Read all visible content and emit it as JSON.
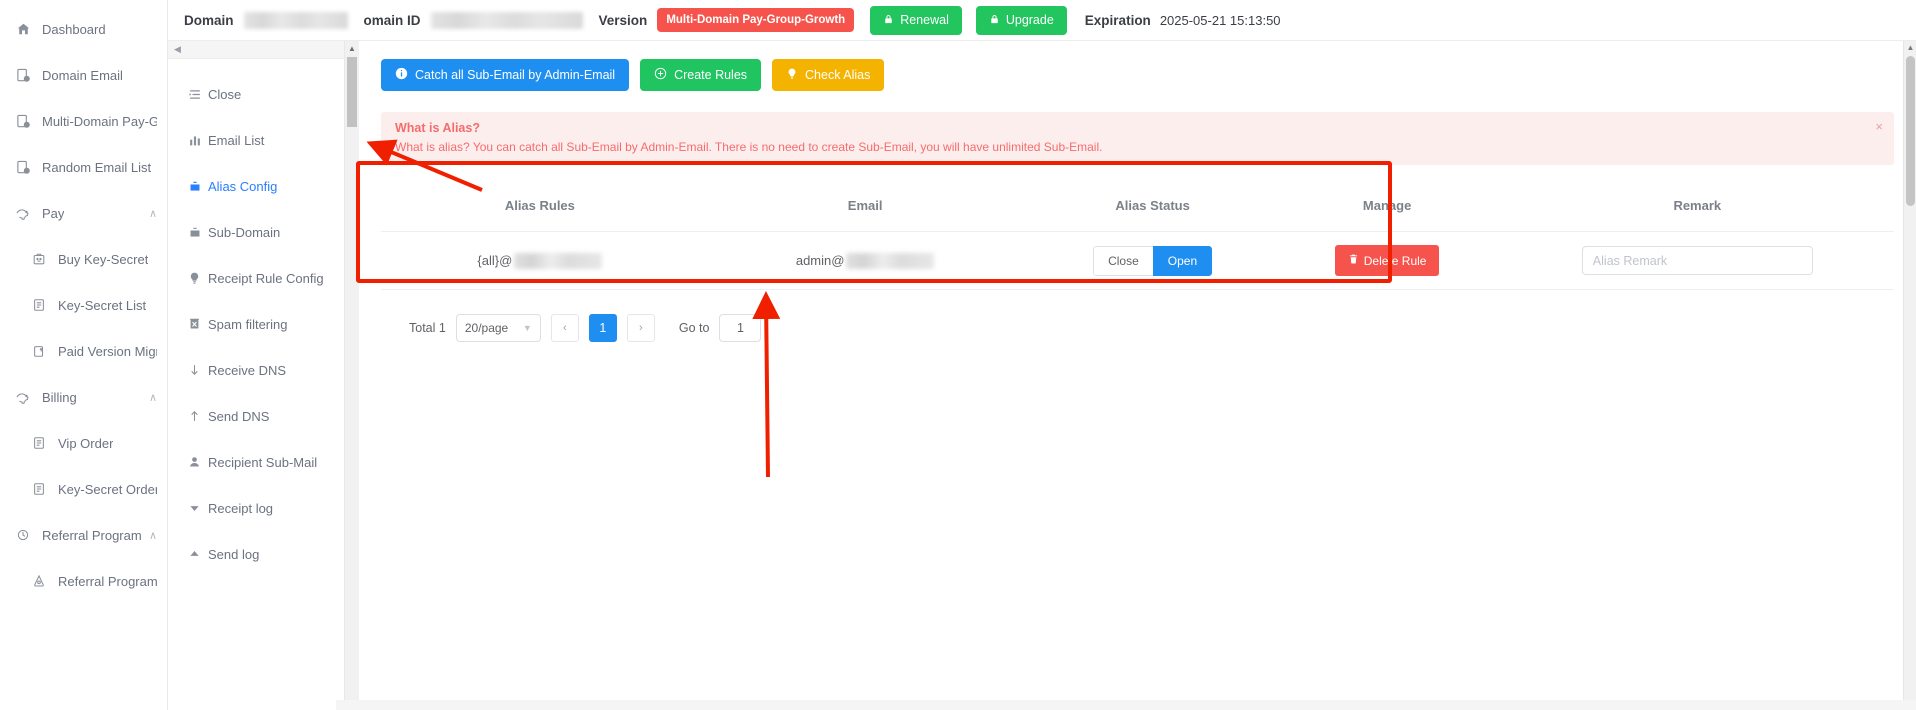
{
  "topbar": {
    "domain_label": "Domain",
    "domain_id_label": "omain ID",
    "version_label": "Version",
    "version_badge": "Multi-Domain Pay-Group-Growth",
    "renewal_button": "Renewal",
    "upgrade_button": "Upgrade",
    "expiration_label": "Expiration",
    "expiration_value": "2025-05-21 15:13:50"
  },
  "sidebar": {
    "items": [
      {
        "label": "Dashboard",
        "icon": "home-icon",
        "level": "top"
      },
      {
        "label": "Domain Email",
        "icon": "domain-icon",
        "level": "top"
      },
      {
        "label": "Multi-Domain Pay-Group",
        "icon": "domain-icon",
        "level": "top"
      },
      {
        "label": "Random Email List",
        "icon": "domain-icon",
        "level": "top"
      },
      {
        "label": "Pay",
        "icon": "pay-icon",
        "level": "group",
        "caret": "∧"
      },
      {
        "label": "Buy Key-Secret",
        "icon": "key-icon",
        "level": "sub"
      },
      {
        "label": "Key-Secret List",
        "icon": "list-icon",
        "level": "sub"
      },
      {
        "label": "Paid Version Migration",
        "icon": "upload-icon",
        "level": "sub"
      },
      {
        "label": "Billing",
        "icon": "pay-icon",
        "level": "group",
        "caret": "∧"
      },
      {
        "label": "Vip Order",
        "icon": "list-icon",
        "level": "sub"
      },
      {
        "label": "Key-Secret Order",
        "icon": "list-icon",
        "level": "sub"
      },
      {
        "label": "Referral Program",
        "icon": "gift-icon",
        "level": "group",
        "caret": "∧"
      },
      {
        "label": "Referral Program",
        "icon": "referral-icon",
        "level": "sub"
      }
    ]
  },
  "subsidebar": {
    "collapse_icon": "◀",
    "items": [
      {
        "label": "Close",
        "icon": "close-list-icon",
        "active": false
      },
      {
        "label": "Email List",
        "icon": "bar-chart-icon",
        "active": false
      },
      {
        "label": "Alias Config",
        "icon": "alias-icon",
        "active": true
      },
      {
        "label": "Sub-Domain",
        "icon": "subdomain-icon",
        "active": false
      },
      {
        "label": "Receipt Rule Config",
        "icon": "bulb-icon",
        "active": false
      },
      {
        "label": "Spam filtering",
        "icon": "spam-icon",
        "active": false
      },
      {
        "label": "Receive DNS",
        "icon": "arrow-down-icon",
        "active": false
      },
      {
        "label": "Send DNS",
        "icon": "arrow-up-icon",
        "active": false
      },
      {
        "label": "Recipient Sub-Mail",
        "icon": "user-icon",
        "active": false
      },
      {
        "label": "Receipt log",
        "icon": "triangle-down-icon",
        "active": false
      },
      {
        "label": "Send log",
        "icon": "triangle-up-icon",
        "active": false
      }
    ]
  },
  "toolbar": {
    "catch_all_button": "Catch all Sub-Email by Admin-Email",
    "catch_all_icon": "info-icon",
    "create_rules_button": "Create Rules",
    "create_rules_icon": "plus-circle-icon",
    "check_alias_button": "Check Alias",
    "check_alias_icon": "bulb-icon"
  },
  "alert": {
    "title": "What is Alias?",
    "description": "What is alias? You can catch all Sub-Email by Admin-Email. There is no need to create Sub-Email, you will have unlimited Sub-Email.",
    "close_icon": "×"
  },
  "table": {
    "headers": [
      "Alias Rules",
      "Email",
      "Alias Status",
      "Manage",
      "Remark"
    ],
    "rows": [
      {
        "alias_rule_prefix": "{all}@",
        "alias_rule_domain_redacted": true,
        "email_prefix": "admin@",
        "email_domain_redacted": true,
        "status_close_label": "Close",
        "status_open_label": "Open",
        "status_selected": "Open",
        "delete_label": "Delete Rule",
        "delete_icon": "trash-icon",
        "remark_value": "",
        "remark_placeholder": "Alias Remark"
      }
    ]
  },
  "pagination": {
    "total_label": "Total 1",
    "page_size": "20/page",
    "prev_icon": "‹",
    "next_icon": "›",
    "current_page": "1",
    "goto_label": "Go to",
    "goto_value": "1"
  },
  "annotations": {
    "highlight_color": "#f01f00",
    "arrow_to_alias_config": "arrow-pointing-to-alias-config",
    "arrow_to_table": "arrow-pointing-to-alias-table",
    "rect_around_table": "rect-highlight-alias-table"
  }
}
